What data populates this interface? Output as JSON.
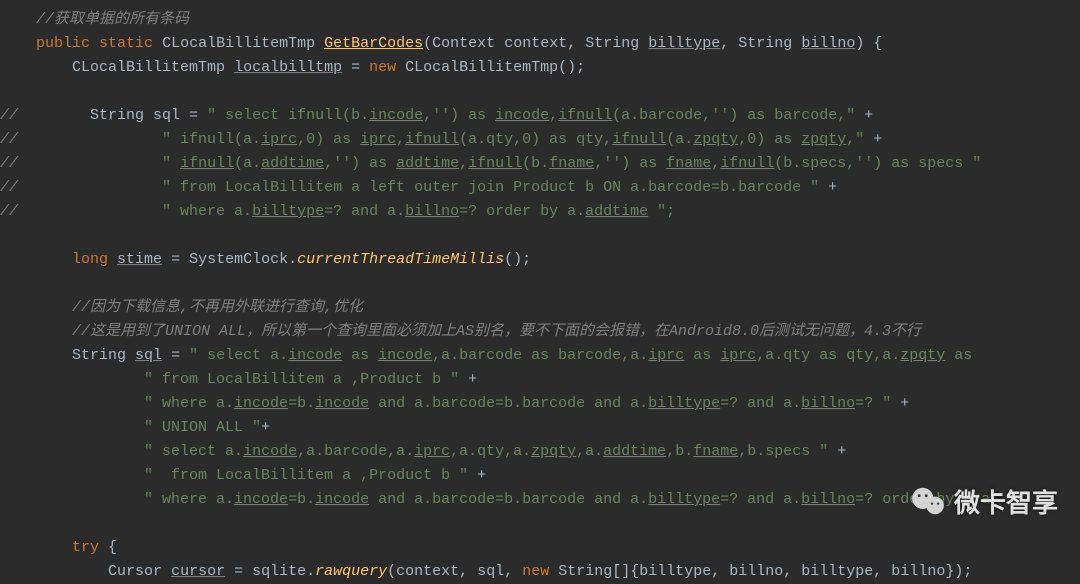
{
  "code": {
    "c1": "//获取单据的所有条码",
    "kw_public": "public",
    "kw_static": "static",
    "kw_new": "new",
    "kw_long": "long",
    "kw_try": "try",
    "type_CLocalBillitemTmp": "CLocalBillitemTmp",
    "type_Context": "Context",
    "type_String": "String",
    "type_SystemClock": "SystemClock",
    "type_Cursor": "Cursor",
    "m_GetBarCodes": "GetBarCodes",
    "m_currentThreadTimeMillis": "currentThreadTimeMillis",
    "m_rawquery": "rawquery",
    "p_context": "context",
    "p_billtype": "billtype",
    "p_billno": "billno",
    "v_localbilltmp": "localbilltmp",
    "v_stime": "stime",
    "v_sql": "sql",
    "v_cursor": "cursor",
    "v_sqlite": "sqlite",
    "gut": "//",
    "sql_old_l1_a": "String sql = ",
    "sql_old_l1_b": "\" select ifnull(b.",
    "w_incode": "incode",
    "sql_old_l1_c": ",'') as ",
    "sql_old_l1_d": ",",
    "w_ifnull": "ifnull",
    "sql_old_l1_e": "(a.barcode,'') as barcode,\"",
    "plus": " +",
    "sql_old_l2_a": "\" ifnull(a.",
    "w_iprc": "iprc",
    "sql_old_l2_b": ",0) as ",
    "sql_old_l2_c": "(a.qty,0) as qty,",
    "sql_old_l2_d": "(a.",
    "w_zpqty": "zpqty",
    "sql_old_l2_e": ",0) as ",
    "sql_old_l2_f": ",\"",
    "sql_old_l3_a": "(a.",
    "w_addtime": "addtime",
    "sql_old_l3_b": ",'') as ",
    "sql_old_l3_c": "(b.",
    "w_fname": "fname",
    "sql_old_l3_d": ",'') as ",
    "sql_old_l3_e": ",",
    "sql_old_l3_f": "(b.specs,'') as specs \"",
    "sql_old_l4": "\" from LocalBillitem a left outer join Product b ON a.barcode=b.barcode \"",
    "sql_old_l5_a": "\" where a.",
    "w_billtype": "billtype",
    "sql_old_l5_b": "=? and a.",
    "w_billno": "billno",
    "sql_old_l5_c": "=? order by a.",
    "sql_old_l5_d": " \";",
    "cmt2": "//因为下载信息,不再用外联进行查询,优化",
    "cmt3": "//这是用到了UNION ALL，所以第一个查询里面必须加上AS别名，要不下面的会报错，在Android8.0后测试无问题，4.3不行",
    "sql_new_l1_a": "\" select a.",
    "sql_new_l1_b": " as ",
    "sql_new_l1_c": ",a.barcode as barcode,a.",
    "sql_new_l1_d": " as ",
    "sql_new_l1_e": ",a.qty as qty,a.",
    "sql_new_l1_f": " as ",
    "sql_new_l2": "\" from LocalBillitem a ,Product b \"",
    "sql_new_l3_a": "\" where a.",
    "sql_new_l3_b": "=b.",
    "sql_new_l3_c": " and a.barcode=b.barcode and a.",
    "sql_new_l3_d": "=? and a.",
    "sql_new_l3_e": "=? \"",
    "sql_new_l4": "\" UNION ALL \"",
    "sql_new_l5_a": "\" select a.",
    "sql_new_l5_b": ",a.barcode,a.",
    "sql_new_l5_c": ",a.qty,a.",
    "sql_new_l5_d": ",a.",
    "sql_new_l5_e": ",b.",
    "sql_new_l5_f": ",b.specs \"",
    "sql_new_l6": "\"  from LocalBillitem a ,Product b \"",
    "sql_new_l7_a": "\" where a.",
    "sql_new_l7_b": "=b.",
    "sql_new_l7_c": " and a.barcode=b.barcode and a.",
    "sql_new_l7_d": "=? and a.",
    "sql_new_l7_e": "=? order by a.",
    "cursor_tail": "[]{billtype, billno, billtype, billno});"
  },
  "brand": "微卡智享"
}
